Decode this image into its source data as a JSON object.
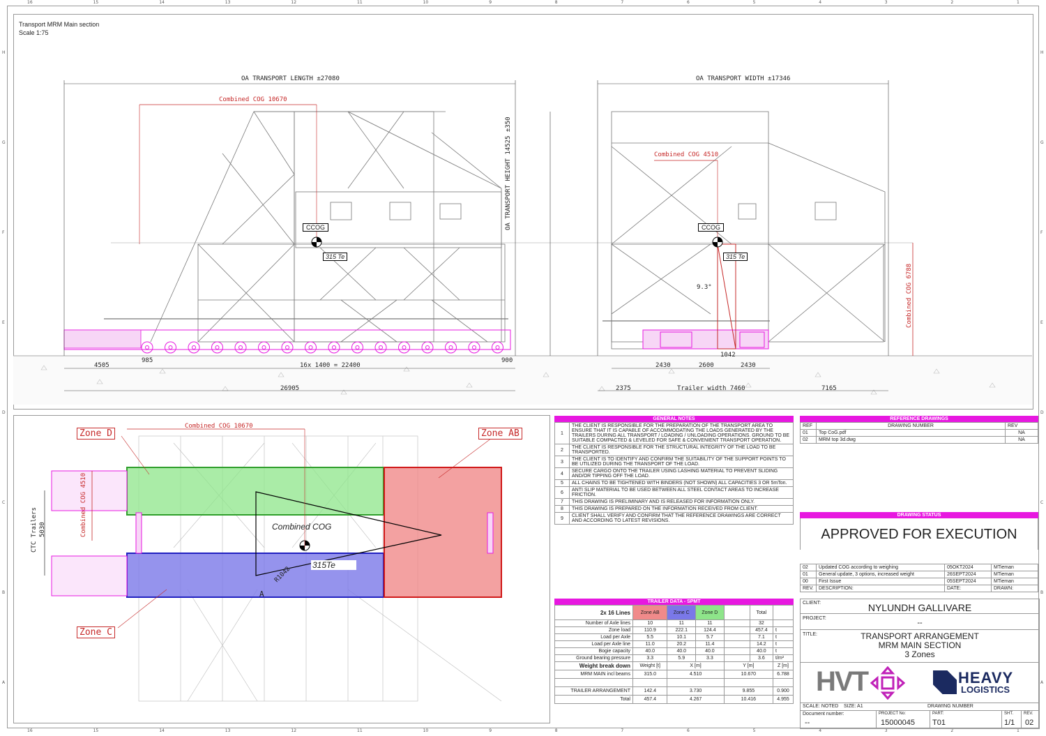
{
  "border_ruler": {
    "top": [
      "16",
      "15",
      "14",
      "13",
      "12",
      "11",
      "10",
      "9",
      "8",
      "7",
      "6",
      "5",
      "4",
      "3",
      "2",
      "1"
    ],
    "side": [
      "H",
      "G",
      "F",
      "E",
      "D",
      "C",
      "B",
      "A"
    ]
  },
  "view_title": {
    "line1": "Transport MRM Main section",
    "line2": "Scale 1:75"
  },
  "dims": {
    "oa_length": "OA TRANSPORT LENGTH ±27080",
    "oa_width": "OA TRANSPORT WIDTH ±17346",
    "oa_height": "OA TRANSPORT HEIGHT 14525 ±350",
    "cog_10670": "Combined COG 10670",
    "cog_4510": "Combined COG 4510",
    "cog_6788": "Combined COG 6788",
    "ccog": "CCOG",
    "load": "315 Te",
    "angle": "9.3°",
    "d4505": "4505",
    "d985": "985",
    "d16x": "16x 1400 = 22400",
    "d900": "900",
    "d26905": "26905",
    "d2430a": "2430",
    "d2600": "2600",
    "d2430b": "2430",
    "d1042": "1042",
    "d2375": "2375",
    "trailer_width": "Trailer width 7460",
    "d7165": "7165"
  },
  "plan": {
    "zone_d": "Zone D",
    "zone_ab": "Zone AB",
    "zone_c": "Zone C",
    "cog_10670": "Combined COG 10670",
    "cog_4510": "Combined COG 4510",
    "combined_cog": "Combined COG",
    "load": "315Te",
    "radius": "R1042",
    "ctc_trailers": "CTC Trailers",
    "ctc_value": "5030",
    "marker_a": "A"
  },
  "colors": {
    "magenta": "#e718e0",
    "zone_green": "#8ee58a",
    "zone_blue": "#7a78e8",
    "zone_red": "#f08a8a",
    "red_line": "#c62828"
  },
  "general_notes": {
    "title": "GENERAL NOTES",
    "items": [
      {
        "n": "1",
        "text": "THE CLIENT IS RESPONSIBLE FOR THE PREPARATION OF THE TRANSPORT AREA TO ENSURE THAT IT IS CAPABLE OF ACCOMMODATING THE LOADS GENERATED BY THE TRAILERS DURING ALL TRANSPORT / LOADING / UNLOADING OPERATIONS. GROUND TO BE SUITABLE COMPACTED & LEVELED FOR SAFE & CONVENIENT TRANSPORT OPERATION."
      },
      {
        "n": "2",
        "text": "THE CLIENT IS RESPONSIBLE FOR THE STRUCTURAL INTEGRITY OF THE LOAD TO BE TRANSPORTED."
      },
      {
        "n": "3",
        "text": "THE CLIENT IS TO IDENTIFY AND CONFIRM THE SUITABILITY OF THE SUPPORT POINTS TO BE UTILIZED DURING THE TRANSPORT OF THE LOAD."
      },
      {
        "n": "4",
        "text": "SECURE CARGO ONTO THE TRAILER USING LASHING MATERIAL TO PREVENT SLIDING AND/OR TIPPING OFF THE LOAD."
      },
      {
        "n": "5",
        "text": "ALL CHAINS TO BE TIGHTENED WITH BINDERS (NOT SHOWN) ALL CAPACITIES 3 OR 5mTon."
      },
      {
        "n": "6",
        "text": "ANTI SLIP MATERIAL TO BE USED BETWEEN ALL STEEL CONTACT AREAS TO INCREASE FRICTION."
      },
      {
        "n": "7",
        "text": "THIS DRAWING IS PRELIMINARY AND IS RELEASED FOR INFORMATION ONLY."
      },
      {
        "n": "8",
        "text": "THIS DRAWING IS PREPARED ON THE INFORMATION RECEIVED FROM CLIENT."
      },
      {
        "n": "9",
        "text": "CLIENT SHALL VERIFY AND CONFIRM THAT THE REFERENCE DRAWINGS ARE CORRECT AND ACCORDING TO LATEST REVISIONS."
      }
    ]
  },
  "reference_drawings": {
    "title": "REFERENCE DRAWINGS",
    "headers": [
      "REF",
      "DRAWING NUMBER",
      "REV"
    ],
    "rows": [
      [
        "01",
        "Top CoG.pdf",
        "NA"
      ],
      [
        "02",
        "MRM top 3d.dwg",
        "NA"
      ]
    ]
  },
  "drawing_status": {
    "title": "DRAWING STATUS",
    "value": "APPROVED FOR EXECUTION"
  },
  "revisions": {
    "rows": [
      [
        "02",
        "Updated COG according to weighing",
        "05OKT2024",
        "MTieman"
      ],
      [
        "01",
        "General update, 3 options, increased weight",
        "26SEPT2024",
        "MTieman"
      ],
      [
        "00",
        "First Issue",
        "05SEPT2024",
        "MTieman"
      ]
    ],
    "headers": [
      "REV.",
      "DESCRIPTION:",
      "DATE:",
      "DRAWN:"
    ]
  },
  "title_block": {
    "client_label": "CLIENT:",
    "client": "NYLUNDH GALLIVARE",
    "project_label": "PROJECT:",
    "project": "--",
    "title_label": "TITLE:",
    "title_lines": [
      "TRANSPORT ARRANGEMENT",
      "MRM MAIN SECTION",
      "3 Zones"
    ],
    "logo_hvt": "HVT",
    "logo_heavy": "HEAVY",
    "logo_logistics": "LOGISTICS",
    "scale": "SCALE: NOTED",
    "size": "SIZE: A1",
    "drawing_number_label": "DRAWING NUMBER",
    "document_number_label": "Document number:",
    "document_number": "--",
    "project_no_label": "PROJECT No:",
    "project_no": "15000045",
    "part_label": "PART:",
    "part": "T01",
    "sht_label": "SHT.",
    "sht": "1/1",
    "rev_label": "REV.",
    "rev": "02"
  },
  "trailer_data": {
    "title": "TRAILER DATA - SPMT",
    "corner": "2x 16 Lines",
    "cols": [
      "Zone AB",
      "Zone C",
      "Zone D",
      "",
      "Total",
      ""
    ],
    "rows": [
      {
        "label": "Number of Axle lines",
        "vals": [
          "10",
          "11",
          "11",
          "",
          "32",
          ""
        ]
      },
      {
        "label": "Zone load",
        "vals": [
          "110.9",
          "222.1",
          "124.4",
          "",
          "457.4",
          "t"
        ]
      },
      {
        "label": "Load per Axle",
        "vals": [
          "5.5",
          "10.1",
          "5.7",
          "",
          "7.1",
          "t"
        ]
      },
      {
        "label": "Load per Axle line",
        "vals": [
          "11.0",
          "20.2",
          "11.4",
          "",
          "14.2",
          "t"
        ]
      },
      {
        "label": "Bogie capacity",
        "vals": [
          "40.0",
          "40.0",
          "40.0",
          "",
          "40.0",
          "t"
        ]
      },
      {
        "label": "Ground bearing pressure",
        "vals": [
          "3.3",
          "5.9",
          "3.3",
          "",
          "3.6",
          "t/m²"
        ]
      }
    ],
    "weight_header": {
      "label": "Weight break down",
      "vals": [
        "Weight [t]",
        "X [m]",
        "Y [m]",
        "Z [m]"
      ]
    },
    "weight_rows": [
      {
        "label": "MRM MAIN incl beams",
        "vals": [
          "315.0",
          "4.510",
          "10.670",
          "6.788"
        ]
      },
      {
        "label": "",
        "vals": [
          "",
          "",
          "",
          ""
        ]
      },
      {
        "label": "TRAILER ARRANGEMENT",
        "vals": [
          "142.4",
          "3.730",
          "9.855",
          "0.900"
        ]
      },
      {
        "label": "Total",
        "vals": [
          "457.4",
          "4.267",
          "10.416",
          "4.955"
        ]
      }
    ]
  }
}
